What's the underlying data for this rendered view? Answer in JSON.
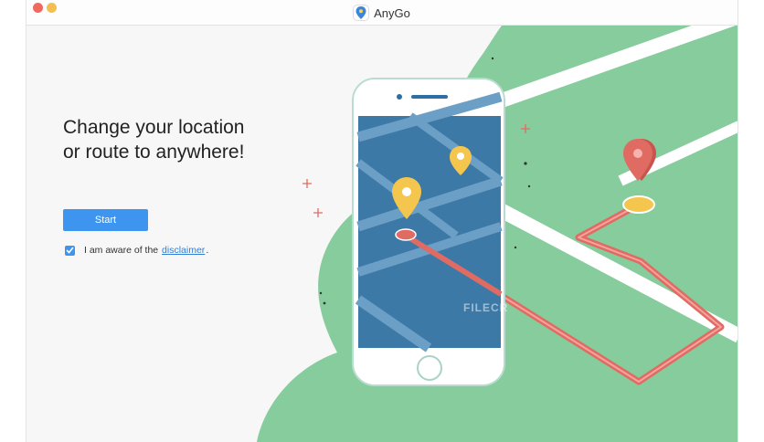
{
  "window": {
    "title": "AnyGo",
    "app_icon": "map-pin-icon"
  },
  "hero": {
    "headline_line1": "Change your location",
    "headline_line2": "or route to anywhere!"
  },
  "actions": {
    "start_label": "Start"
  },
  "disclaimer": {
    "checked": true,
    "prefix": "I am aware of the",
    "link_text": "disclaimer",
    "suffix": "."
  },
  "watermark": "FILECR",
  "colors": {
    "accent": "#3d95ef",
    "map_green": "#86cc9c",
    "route_red": "#e06b63",
    "pin_yellow": "#f4c64d",
    "phone_map": "#3d79a6"
  }
}
